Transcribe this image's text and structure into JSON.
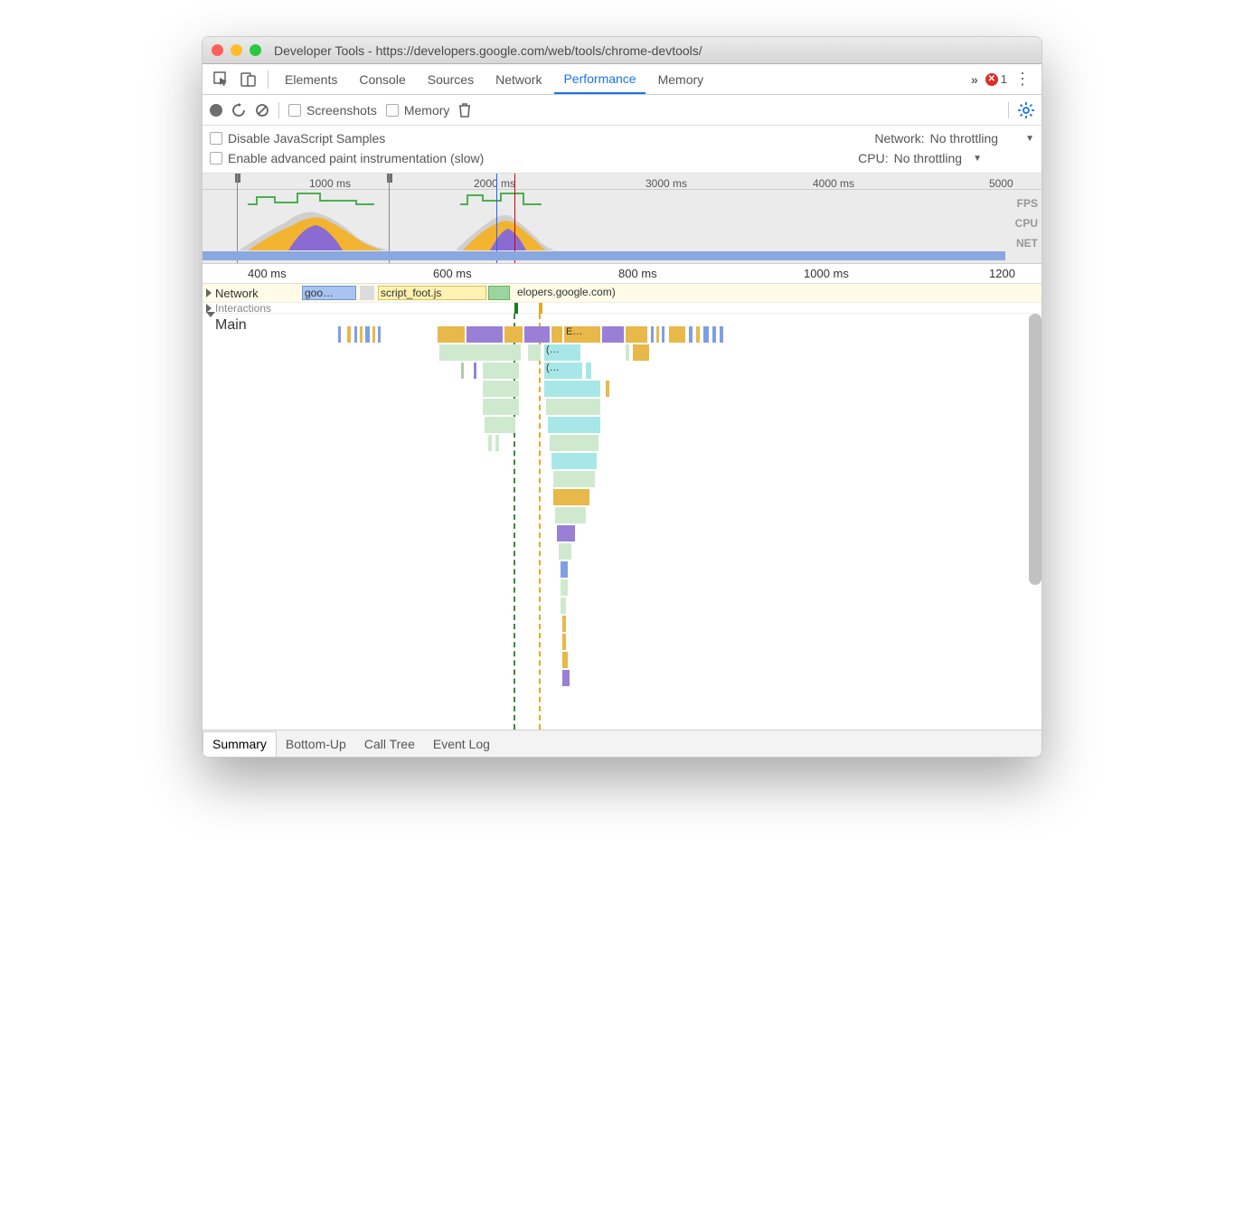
{
  "window": {
    "title": "Developer Tools - https://developers.google.com/web/tools/chrome-devtools/"
  },
  "tabs": {
    "items": [
      "Elements",
      "Console",
      "Sources",
      "Network",
      "Performance",
      "Memory"
    ],
    "active": "Performance",
    "more_icon": "»",
    "error_count": "1"
  },
  "toolbar": {
    "screenshots": "Screenshots",
    "memory": "Memory"
  },
  "options": {
    "disable_js": "Disable JavaScript Samples",
    "enable_paint": "Enable advanced paint instrumentation (slow)",
    "network_label": "Network:",
    "network_value": "No throttling",
    "cpu_label": "CPU:",
    "cpu_value": "No throttling"
  },
  "overview": {
    "ticks": [
      "1000 ms",
      "2000 ms",
      "3000 ms",
      "4000 ms",
      "5000"
    ],
    "labels": {
      "fps": "FPS",
      "cpu": "CPU",
      "net": "NET"
    }
  },
  "ruler": {
    "ticks": [
      "400 ms",
      "600 ms",
      "800 ms",
      "1000 ms",
      "1200"
    ]
  },
  "tracks": {
    "network": "Network",
    "net_items": [
      "goo…",
      "script_foot.js",
      "elopers.google.com)"
    ],
    "interactions": "Interactions",
    "main": "Main",
    "frame_labels": [
      "E…",
      "(…",
      "(…"
    ]
  },
  "bottom_tabs": {
    "items": [
      "Summary",
      "Bottom-Up",
      "Call Tree",
      "Event Log"
    ],
    "active": "Summary"
  }
}
